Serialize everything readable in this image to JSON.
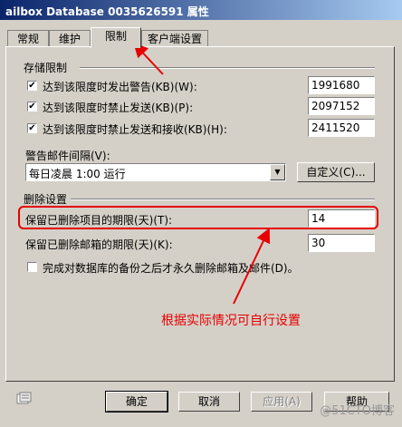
{
  "window": {
    "title": "ailbox Database 0035626591 属性"
  },
  "tabs": [
    {
      "label": "常规"
    },
    {
      "label": "维护"
    },
    {
      "label": "限制"
    },
    {
      "label": "客户端设置"
    }
  ],
  "storage_limits": {
    "label": "存储限制",
    "warn": {
      "label": "达到该限度时发出警告(KB)(W):",
      "value": "1991680",
      "checked": true
    },
    "prohibit_send": {
      "label": "达到该限度时禁止发送(KB)(P):",
      "value": "2097152",
      "checked": true
    },
    "prohibit_send_receive": {
      "label": "达到该限度时禁止发送和接收(KB)(H):",
      "value": "2411520",
      "checked": true
    },
    "warning_interval": {
      "label": "警告邮件间隔(V):",
      "selected": "每日凌晨 1:00 运行",
      "customize_button": "自定义(C)..."
    }
  },
  "deletion_settings": {
    "label": "删除设置",
    "items_retention": {
      "label": "保留已删除项目的期限(天)(T):",
      "value": "14"
    },
    "mailbox_retention": {
      "label": "保留已删除邮箱的期限(天)(K):",
      "value": "30"
    },
    "backup_checkbox": {
      "label": "完成对数据库的备份之后才永久删除邮箱及邮件(D)。",
      "checked": false
    }
  },
  "annotation": {
    "text": "根据实际情况可自行设置"
  },
  "buttons": {
    "ok": "确定",
    "cancel": "取消",
    "apply": "应用(A)",
    "help": "帮助"
  },
  "watermark": "@51CTO博客",
  "colors": {
    "annotation": "#e60000",
    "title_bar": "#0a246a",
    "dialog_bg": "#d4d0c8"
  }
}
